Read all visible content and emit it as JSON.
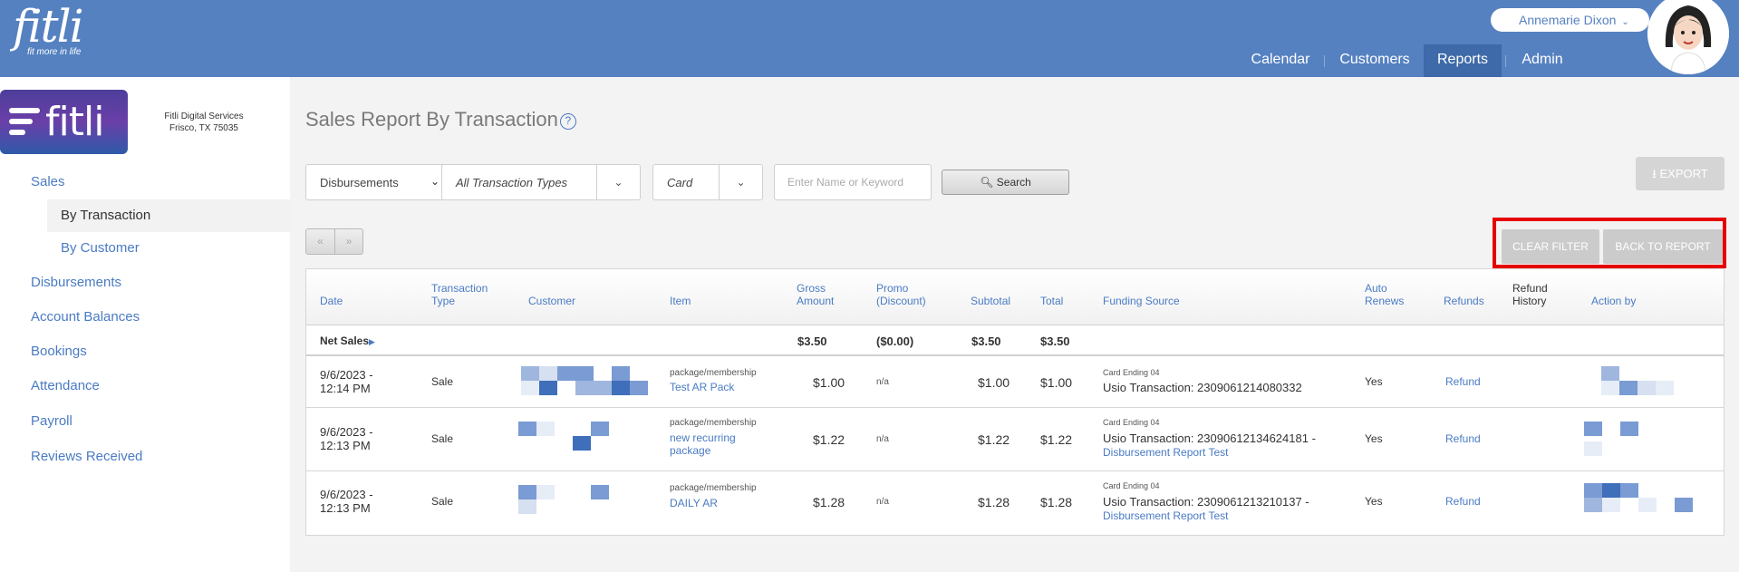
{
  "header": {
    "logo_word": "fitli",
    "logo_tagline": "fit more in life",
    "user_name": "Annemarie Dixon",
    "nav": [
      {
        "label": "Calendar"
      },
      {
        "label": "Customers"
      },
      {
        "label": "Reports"
      },
      {
        "label": "Admin"
      }
    ]
  },
  "sidebar": {
    "brand_word": "fitli",
    "address_line1": "Fitli Digital Services",
    "address_line2": "Frisco, TX 75035",
    "items": {
      "sales": "Sales",
      "by_transaction": "By Transaction",
      "by_customer": "By Customer",
      "disbursements": "Disbursements",
      "account_balances": "Account Balances",
      "bookings": "Bookings",
      "attendance": "Attendance",
      "payroll": "Payroll",
      "reviews_received": "Reviews Received"
    }
  },
  "page": {
    "title": "Sales Report By Transaction",
    "help_glyph": "?"
  },
  "filters": {
    "report_select": "Disbursements",
    "transaction_types": "All Transaction Types",
    "payment_type": "Card",
    "search_placeholder": "Enter Name or Keyword",
    "search_label": "Search"
  },
  "buttons": {
    "export": "EXPORT",
    "clear_filter": "CLEAR FILTER",
    "back_to_report": "BACK TO REPORT",
    "prev": "«",
    "next": "»"
  },
  "table": {
    "headers": {
      "date": "Date",
      "transaction_type_1": "Transaction",
      "transaction_type_2": "Type",
      "customer": "Customer",
      "item": "Item",
      "gross_1": "Gross",
      "gross_2": "Amount",
      "promo_1": "Promo",
      "promo_2": "(Discount)",
      "subtotal": "Subtotal",
      "total": "Total",
      "funding_source": "Funding Source",
      "auto_1": "Auto",
      "auto_2": "Renews",
      "refunds": "Refunds",
      "refund_hist_1": "Refund",
      "refund_hist_2": "History",
      "action_by": "Action by"
    },
    "net_sales": {
      "label": "Net Sales",
      "gross": "$3.50",
      "promo": "($0.00)",
      "subtotal": "$3.50",
      "total": "$3.50"
    },
    "rows": [
      {
        "date_1": "9/6/2023 -",
        "date_2": "12:14 PM",
        "type": "Sale",
        "item_kind": "package/membership",
        "item_1": "Test AR Pack",
        "item_2": "",
        "gross": "$1.00",
        "promo": "n/a",
        "subtotal": "$1.00",
        "total": "$1.00",
        "card": "Card Ending 04",
        "funding_1": "Usio Transaction: 2309061214080332",
        "funding_2": "",
        "auto_renews": "Yes",
        "refund": "Refund"
      },
      {
        "date_1": "9/6/2023 -",
        "date_2": "12:13 PM",
        "type": "Sale",
        "item_kind": "package/membership",
        "item_1": "new recurring",
        "item_2": "package",
        "gross": "$1.22",
        "promo": "n/a",
        "subtotal": "$1.22",
        "total": "$1.22",
        "card": "Card Ending 04",
        "funding_1": "Usio Transaction: 23090612134624181 -",
        "funding_2": "Disbursement Report Test",
        "auto_renews": "Yes",
        "refund": "Refund"
      },
      {
        "date_1": "9/6/2023 -",
        "date_2": "12:13 PM",
        "type": "Sale",
        "item_kind": "package/membership",
        "item_1": "DAILY AR",
        "item_2": "",
        "gross": "$1.28",
        "promo": "n/a",
        "subtotal": "$1.28",
        "total": "$1.28",
        "card": "Card Ending 04",
        "funding_1": "Usio Transaction: 2309061213210137 -",
        "funding_2": "Disbursement Report Test",
        "auto_renews": "Yes",
        "refund": "Refund"
      }
    ]
  },
  "colors": {
    "header_blue": "#5581c1",
    "link_blue": "#4a7bc4",
    "highlight_red": "#e60000"
  }
}
